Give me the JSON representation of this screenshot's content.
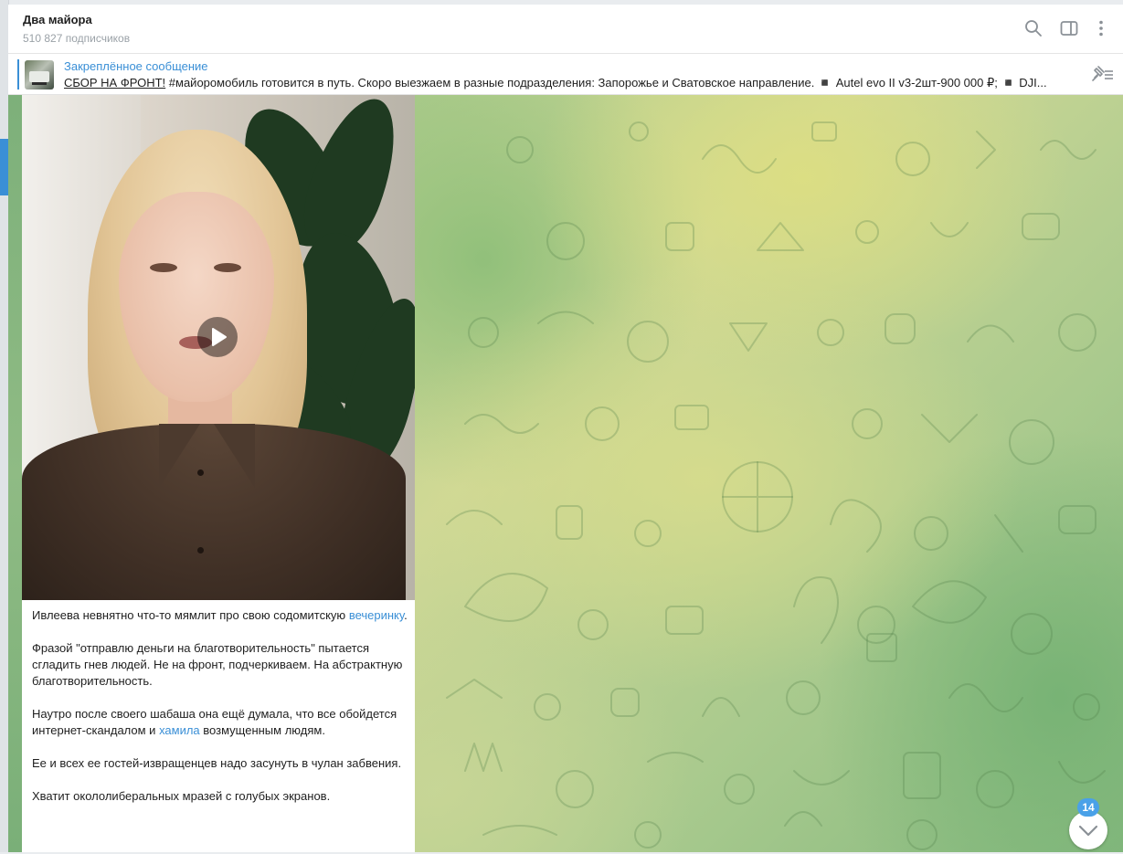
{
  "header": {
    "title": "Два майора",
    "subtitle": "510 827 подписчиков",
    "icons": [
      "search-icon",
      "sidebar-toggle-icon",
      "more-vertical-icon"
    ]
  },
  "pinned": {
    "title": "Закреплённое сообщение",
    "text_link": "СБОР НА ФРОНТ!",
    "text_rest": " #майоромобиль готовится в путь. Скоро выезжаем  в разные подразделения: Запорожье и Сватовское направление.   ◾️ Autel evo II v3-2шт-900 000 ₽;  ◾️ DJI...",
    "icon": "unpin-list-icon"
  },
  "message": {
    "video_icon": "play-icon",
    "p1_a": "Ивлеева невнятно что-то мямлит про свою содомитскую ",
    "p1_link": "вечеринку",
    "p1_b": ".",
    "p2": "Фразой \"отправлю деньги на благотворительность\" пытается сгладить гнев людей. Не на фронт, подчеркиваем. На абстрактную благотворительность.",
    "p3_a": "Наутро после своего шабаша она ещё думала, что все обойдется интернет-скандалом и ",
    "p3_link": "хамила",
    "p3_b": " возмущенным людям.",
    "p4": "Ее и всех ее гостей-извращенцев надо засунуть в чулан забвения.",
    "p5": "Хватит окололиберальных мразей с голубых экранов."
  },
  "scroll": {
    "unread_count": "14",
    "icon": "chevron-down-icon"
  },
  "colors": {
    "accent": "#3a8fd6",
    "badge": "#4aa1e8"
  }
}
